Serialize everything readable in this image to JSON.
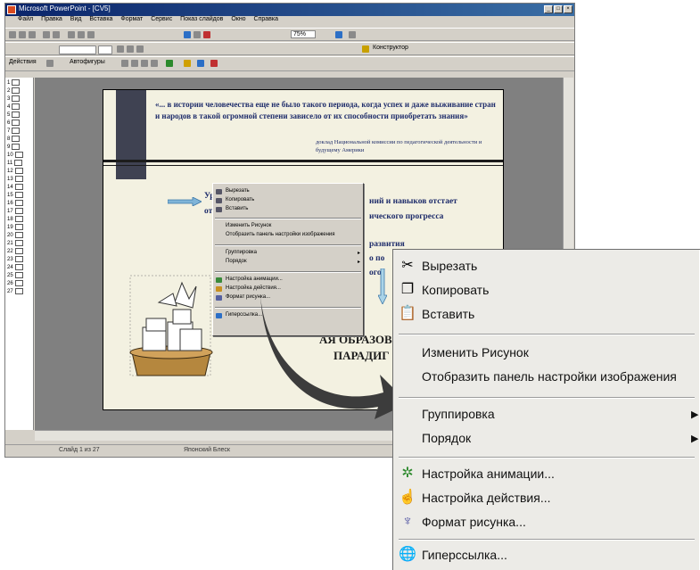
{
  "window": {
    "title": "Microsoft PowerPoint - [CV5]",
    "menu": [
      "Файл",
      "Правка",
      "Вид",
      "Вставка",
      "Формат",
      "Сервис",
      "Показ слайдов",
      "Окно",
      "Справка"
    ],
    "toolbar2_zoom": "75%",
    "toolbar3_label": "Действия",
    "toolbar3_label2": "Автофигуры",
    "toolbar2_right_label": "Конструктор"
  },
  "outline": {
    "rows": [
      "1",
      "2",
      "3",
      "4",
      "5",
      "6",
      "7",
      "8",
      "9",
      "10",
      "11",
      "12",
      "13",
      "14",
      "15",
      "16",
      "17",
      "18",
      "19",
      "20",
      "21",
      "22",
      "23",
      "24",
      "25",
      "26",
      "27"
    ]
  },
  "slide": {
    "quote": "«... в истории человечества еще не было такого периода, когда успех и даже выживание стран и народов в такой огромной степени зависело от их способности приобретать знания»",
    "source": "доклад Национальной комиссии по педагогической деятельности и будущему Америки",
    "line1_left": "Уро",
    "line1_right": "ний и навыков отстает",
    "line2_left": "от",
    "line2_right": "ического прогресса",
    "line3_right": "развития",
    "line4_right": "о по",
    "line5_right": "ого",
    "big1": "АЯ ОБРАЗОВ",
    "big2": "ПАРАДИГ"
  },
  "small_menu": {
    "items": [
      "Вырезать",
      "Копировать",
      "Вставить",
      "Изменить Рисунок",
      "Отобразить панель настройки изображения",
      "Группировка",
      "Порядок",
      "Настройка анимации...",
      "Настройка действия...",
      "Формат рисунка...",
      "Гиперссылка..."
    ]
  },
  "status": {
    "slide": "Слайд 1 из 27",
    "design": "Японский Блеск"
  },
  "big_menu": {
    "cut": "Вырезать",
    "copy": "Копировать",
    "paste": "Вставить",
    "edit_picture": "Изменить Рисунок",
    "show_picture_toolbar": "Отобразить панель настройки изображения",
    "grouping": "Группировка",
    "order": "Порядок",
    "custom_animation": "Настройка анимации...",
    "action_settings": "Настройка действия...",
    "format_picture": "Формат рисунка...",
    "hyperlink": "Гиперссылка..."
  },
  "icons": {
    "cut": "scissors-icon",
    "copy": "copy-icon",
    "paste": "paste-icon",
    "animation": "animation-icon",
    "action": "action-icon",
    "format": "format-picture-icon",
    "hyperlink": "hyperlink-icon"
  },
  "colors": {
    "slide_text": "#1f2d6b",
    "title_bar": "#0a246a",
    "menu_bg": "#ecebe7",
    "arrow": "#3c3c3c"
  }
}
